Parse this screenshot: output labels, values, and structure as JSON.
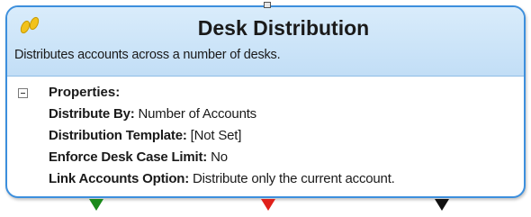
{
  "node": {
    "icon": "footprints-icon",
    "title": "Desk Distribution",
    "description": "Distributes accounts across a number of desks.",
    "properties": {
      "heading": "Properties:",
      "items": [
        {
          "name": "Distribute By:",
          "value": "Number of Accounts"
        },
        {
          "name": "Distribution Template:",
          "value": "[Not Set]"
        },
        {
          "name": "Enforce Desk Case Limit:",
          "value": "No"
        },
        {
          "name": "Link Accounts Option:",
          "value": "Distribute only the current account."
        }
      ]
    },
    "ports": [
      {
        "name": "green-output-port",
        "color": "#1a8a1a"
      },
      {
        "name": "red-output-port",
        "color": "#e0201a"
      },
      {
        "name": "black-output-port",
        "color": "#111111"
      }
    ],
    "colors": {
      "border": "#3c8fdd",
      "header": "#c2def6"
    }
  }
}
